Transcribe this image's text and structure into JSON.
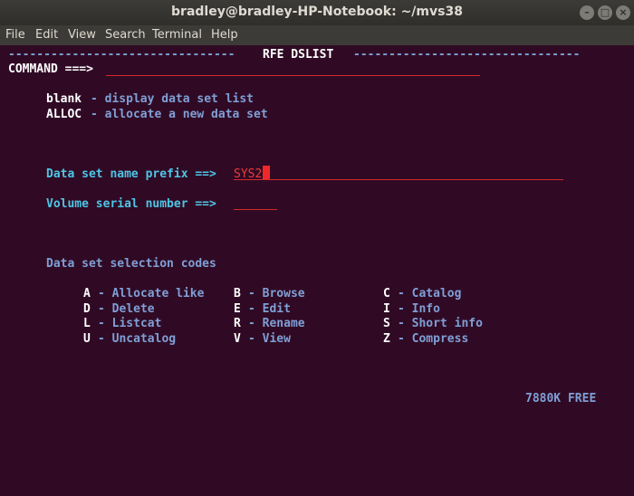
{
  "window": {
    "title": "bradley@bradley-HP-Notebook: ~/mvs38"
  },
  "menu": [
    "File",
    "Edit",
    "View",
    "Search",
    "Terminal",
    "Help"
  ],
  "header": {
    "dashes_left": "--------------------------------",
    "title": "RFE DSLIST",
    "dashes_right": "--------------------------------",
    "command_label": "COMMAND ===>"
  },
  "options": [
    {
      "key": "blank",
      "desc": "- display data set list"
    },
    {
      "key": "ALLOC",
      "desc": "- allocate a new data set"
    }
  ],
  "prefix": {
    "label": "Data set name prefix ==>",
    "value": "SYS2"
  },
  "volume": {
    "label": "Volume serial number ==>",
    "value": ""
  },
  "codes": {
    "heading": "Data set selection codes",
    "items": [
      {
        "code": "A",
        "desc": "- Allocate like"
      },
      {
        "code": "B",
        "desc": "- Browse"
      },
      {
        "code": "C",
        "desc": "- Catalog"
      },
      {
        "code": "D",
        "desc": "- Delete"
      },
      {
        "code": "E",
        "desc": "- Edit"
      },
      {
        "code": "I",
        "desc": "- Info"
      },
      {
        "code": "L",
        "desc": "- Listcat"
      },
      {
        "code": "R",
        "desc": "- Rename"
      },
      {
        "code": "S",
        "desc": "- Short info"
      },
      {
        "code": "U",
        "desc": "- Uncatalog"
      },
      {
        "code": "V",
        "desc": "- View"
      },
      {
        "code": "Z",
        "desc": "- Compress"
      }
    ]
  },
  "free_space": "7880K FREE",
  "colors": {
    "background": "#300a24",
    "white": "#ffffff",
    "blue": "#7f9fd6",
    "cyan": "#4fc5e6",
    "red": "#ef3a3a"
  }
}
